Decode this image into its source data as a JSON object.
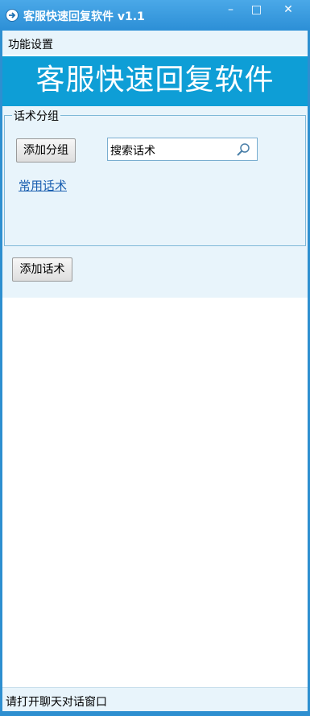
{
  "window": {
    "title": "客服快速回复软件 v1.1",
    "app_icon": "arrow-circle-icon",
    "controls": {
      "minimize": "–",
      "maximize": "□",
      "close": "✕"
    }
  },
  "menu": {
    "items": [
      {
        "label": "功能设置"
      }
    ]
  },
  "banner": {
    "title": "客服快速回复软件"
  },
  "group_box": {
    "legend": "话术分组",
    "add_group_label": "添加分组",
    "search": {
      "value": "搜索话术",
      "icon": "search-icon"
    },
    "groups": [
      {
        "label": "常用话术"
      }
    ]
  },
  "actions": {
    "add_phrase_label": "添加话术"
  },
  "status": {
    "text": "请打开聊天对话窗口"
  },
  "colors": {
    "titlebar": "#2c8fd6",
    "banner": "#0e9ed6",
    "panel": "#e8f4fb",
    "link": "#1a5fb0"
  }
}
